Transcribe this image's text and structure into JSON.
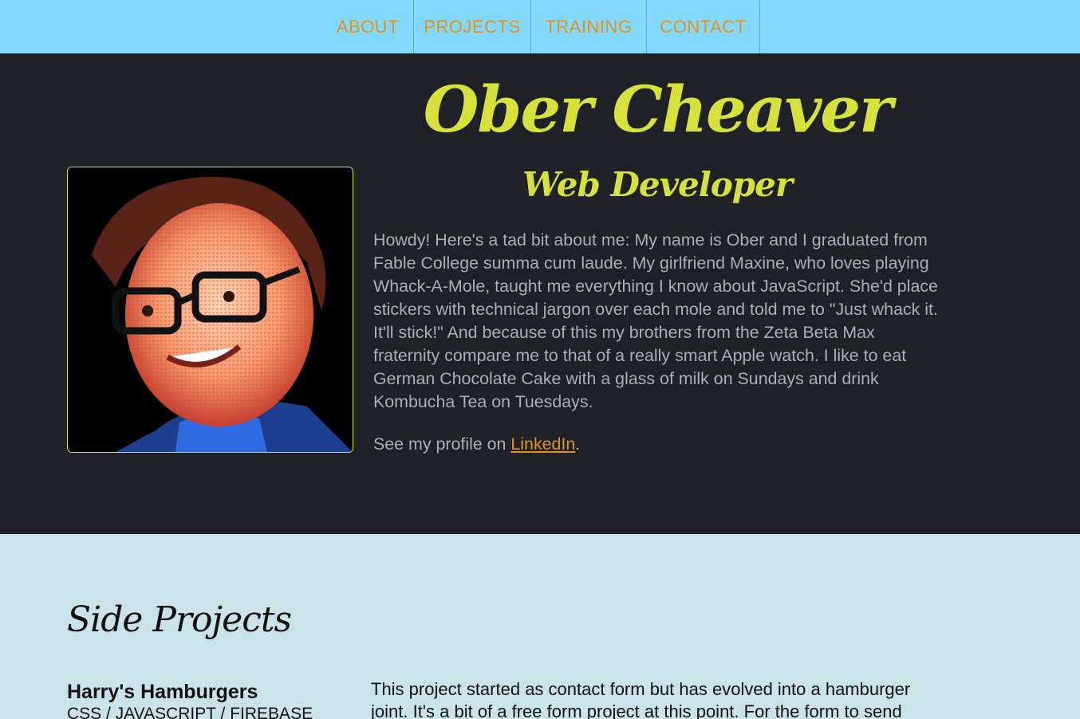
{
  "nav": {
    "items": [
      {
        "label": "ABOUT"
      },
      {
        "label": "PROJECTS"
      },
      {
        "label": "TRAINING"
      },
      {
        "label": "CONTACT"
      }
    ]
  },
  "hero": {
    "name": "Ober Cheaver",
    "role": "Web Developer",
    "bio": "Howdy! Here's a tad bit about me: My name is Ober and I graduated from Fable College summa cum laude. My girlfriend Maxine, who loves playing Whack-A-Mole, taught me everything I know about JavaScript. She'd place stickers with technical jargon over each mole and told me to \"Just whack it. It'll stick!\" And because of this my brothers from the Zeta Beta Max fraternity compare me to that of a really smart Apple watch. I like to eat German Chocolate Cake with a glass of milk on Sundays and drink Kombucha Tea on Tuesdays.",
    "profile_prefix": "See my profile on ",
    "profile_link": "LinkedIn",
    "profile_suffix": "."
  },
  "projects": {
    "title": "Side Projects",
    "items": [
      {
        "name": "Harry's Hamburgers",
        "tech": "CSS / JAVASCRIPT / FIREBASE",
        "description": "This project started as contact form but has evolved into a hamburger joint. It's a bit of a free form project at this point. For the form to send"
      }
    ]
  },
  "colors": {
    "nav_bg": "#83d8fd",
    "nav_text": "#e2921f",
    "hero_bg": "#202126",
    "accent": "#d6e23a",
    "body_text": "#a7aebd",
    "projects_bg": "#cae2ea"
  },
  "icons": [
    "portrait-photo"
  ]
}
